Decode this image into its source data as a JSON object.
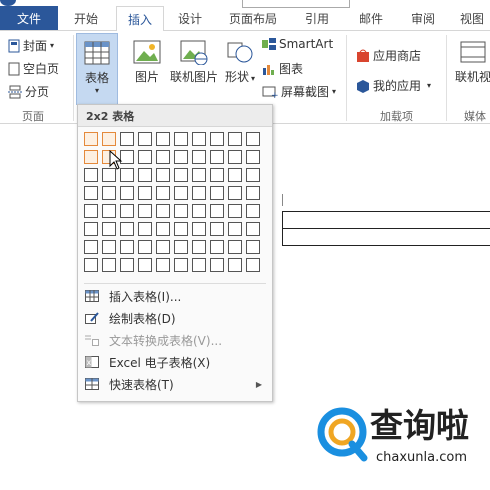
{
  "tabs": {
    "file": "文件",
    "start": "开始",
    "insert": "插入",
    "design": "设计",
    "layout": "页面布局",
    "references": "引用",
    "mail": "邮件",
    "review": "审阅",
    "view": "视图"
  },
  "ribbon": {
    "pages": {
      "cover": "封面",
      "blank": "空白页",
      "break": "分页",
      "group": "页面"
    },
    "table": {
      "label": "表格"
    },
    "illustrations": {
      "picture": "图片",
      "online_picture": "联机图片",
      "shapes": "形状",
      "smartart": "SmartArt",
      "chart": "图表",
      "screenshot": "屏幕截图"
    },
    "addins": {
      "store": "应用商店",
      "my_apps": "我的应用",
      "group": "加载项"
    },
    "media": {
      "online_video": "联机视",
      "group": "媒体"
    }
  },
  "dropdown": {
    "title": "2x2 表格",
    "grid": {
      "cols": 10,
      "rows": 8,
      "selected_cols": 2,
      "selected_rows": 2
    },
    "items": [
      {
        "label": "插入表格(I)...",
        "disabled": false
      },
      {
        "label": "绘制表格(D)",
        "disabled": false
      },
      {
        "label": "文本转换成表格(V)...",
        "disabled": true
      },
      {
        "label": "Excel 电子表格(X)",
        "disabled": false
      },
      {
        "label": "快速表格(T)",
        "disabled": false
      }
    ]
  },
  "watermark": {
    "brand": "查询啦",
    "domain": "chaxunla.com"
  },
  "colors": {
    "accent": "#2b579a",
    "selection": "#e4893b",
    "logo_blue": "#1a8fe0"
  }
}
